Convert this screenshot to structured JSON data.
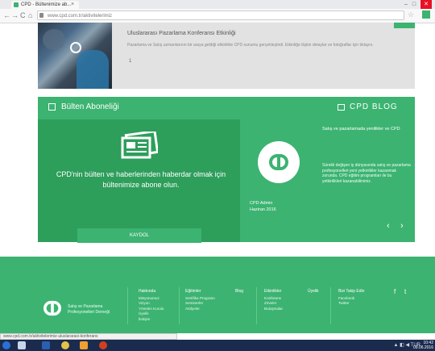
{
  "browser": {
    "tab_title": "CPD - Bültenimize ab...",
    "tab_close": "×",
    "address": "www.cpd.com.tr/aktivitelerimiz",
    "nav_back": "←",
    "nav_forward": "→",
    "nav_reload": "C",
    "nav_home": "⌂",
    "window_controls": [
      "–",
      "□",
      "✕"
    ],
    "star": "☆"
  },
  "event": {
    "title": "Uluslararası Pazarlama Konferansı Etkinliği",
    "description": "Pazarlama ve Satış uzmanlarının bir araya geldiği etkinlikte CPD sunumu gerçekleştirdi. Etkinliğe ilişkin detaylar ve fotoğraflar için tıklayın.",
    "mark": "1"
  },
  "subscription": {
    "title": "Bülten Aboneliği",
    "text": "CPD'nin bülten ve haberlerinden haberdar olmak için bültenimize abone olun.",
    "button": "KAYDOL"
  },
  "blog": {
    "title": "CPD BLOG",
    "headline": "Satış ve pazarlamada yenilikler ve CPD",
    "excerpt": "Sürekli değişen iş dünyasında satış ve pazarlama profesyonelleri yeni yetkinlikler kazanmak zorunda. CPD eğitim programları ile bu yetkinlikleri kazanabilirsiniz.",
    "date_line1": "CPD Admin",
    "date_line2": "Haziran 2016",
    "prev": "‹",
    "next": "›"
  },
  "footer": {
    "org": "Satış ve Pazarlama Profesyonelleri Derneği",
    "columns": [
      {
        "head": "Hakkında",
        "items": [
          "Misyonumuz",
          "Vizyon",
          "Yönetim Kurulu",
          "Üyelik",
          "İletişim"
        ]
      },
      {
        "head": "Eğitimler",
        "items": [
          "Sertifika Programı",
          "Seminerler",
          "Atölyeler"
        ]
      },
      {
        "head": "Blog",
        "items": []
      },
      {
        "head": "Etkinlikler",
        "items": [
          "Konferans",
          "Zirveler",
          "Buluşmalar"
        ]
      },
      {
        "head": "Üyelik",
        "items": []
      },
      {
        "head": "Bizi Takip Edin",
        "items": [
          "Facebook",
          "Twitter"
        ]
      }
    ],
    "social": {
      "facebook": "f",
      "twitter": "t"
    }
  },
  "statusbar": "www.cpd.com.tr/aktivitelerimiz-uluslararasi-konferans",
  "taskbar": {
    "tray": "▲ ◧ ◀ TUR",
    "time": "10:42",
    "date": "09.06.2016"
  },
  "colors": {
    "accent": "#3cb371",
    "accent_dark": "#2e9e5b",
    "taskbar": "#1b2b4e"
  }
}
